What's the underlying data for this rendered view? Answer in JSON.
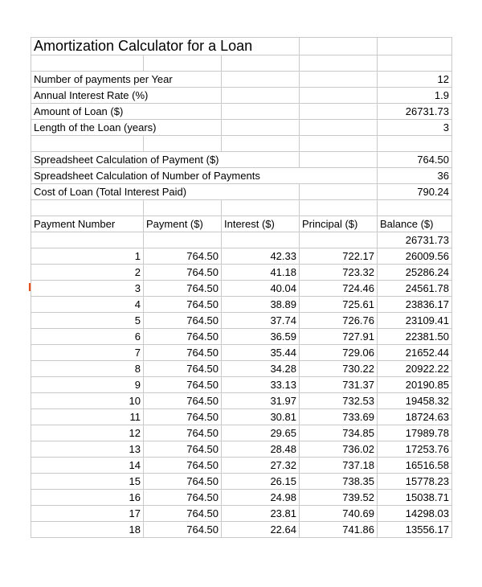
{
  "title": "Amortization Calculator for a Loan",
  "inputs": {
    "payments_per_year_label": "Number of payments per Year",
    "payments_per_year_value": "12",
    "annual_rate_label": "Annual Interest Rate (%)",
    "annual_rate_value": "1.9",
    "amount_label": "Amount of Loan ($)",
    "amount_value": "26731.73",
    "length_label": "Length of the Loan (years)",
    "length_value": "3"
  },
  "calc": {
    "payment_label": "Spreadsheet Calculation of Payment ($)",
    "payment_value": "764.50",
    "num_payments_label": "Spreadsheet Calculation of Number of Payments",
    "num_payments_value": "36",
    "cost_label": "Cost of Loan (Total Interest Paid)",
    "cost_value": "790.24"
  },
  "columns": {
    "c1": "Payment Number",
    "c2": "Payment ($)",
    "c3": "Interest ($)",
    "c4": "Principal ($)",
    "c5": "Balance ($)"
  },
  "start_balance": "26731.73",
  "rows": [
    {
      "n": "1",
      "pay": "764.50",
      "int": "42.33",
      "princ": "722.17",
      "bal": "26009.56"
    },
    {
      "n": "2",
      "pay": "764.50",
      "int": "41.18",
      "princ": "723.32",
      "bal": "25286.24"
    },
    {
      "n": "3",
      "pay": "764.50",
      "int": "40.04",
      "princ": "724.46",
      "bal": "24561.78"
    },
    {
      "n": "4",
      "pay": "764.50",
      "int": "38.89",
      "princ": "725.61",
      "bal": "23836.17"
    },
    {
      "n": "5",
      "pay": "764.50",
      "int": "37.74",
      "princ": "726.76",
      "bal": "23109.41"
    },
    {
      "n": "6",
      "pay": "764.50",
      "int": "36.59",
      "princ": "727.91",
      "bal": "22381.50"
    },
    {
      "n": "7",
      "pay": "764.50",
      "int": "35.44",
      "princ": "729.06",
      "bal": "21652.44"
    },
    {
      "n": "8",
      "pay": "764.50",
      "int": "34.28",
      "princ": "730.22",
      "bal": "20922.22"
    },
    {
      "n": "9",
      "pay": "764.50",
      "int": "33.13",
      "princ": "731.37",
      "bal": "20190.85"
    },
    {
      "n": "10",
      "pay": "764.50",
      "int": "31.97",
      "princ": "732.53",
      "bal": "19458.32"
    },
    {
      "n": "11",
      "pay": "764.50",
      "int": "30.81",
      "princ": "733.69",
      "bal": "18724.63"
    },
    {
      "n": "12",
      "pay": "764.50",
      "int": "29.65",
      "princ": "734.85",
      "bal": "17989.78"
    },
    {
      "n": "13",
      "pay": "764.50",
      "int": "28.48",
      "princ": "736.02",
      "bal": "17253.76"
    },
    {
      "n": "14",
      "pay": "764.50",
      "int": "27.32",
      "princ": "737.18",
      "bal": "16516.58"
    },
    {
      "n": "15",
      "pay": "764.50",
      "int": "26.15",
      "princ": "738.35",
      "bal": "15778.23"
    },
    {
      "n": "16",
      "pay": "764.50",
      "int": "24.98",
      "princ": "739.52",
      "bal": "15038.71"
    },
    {
      "n": "17",
      "pay": "764.50",
      "int": "23.81",
      "princ": "740.69",
      "bal": "14298.03"
    },
    {
      "n": "18",
      "pay": "764.50",
      "int": "22.64",
      "princ": "741.86",
      "bal": "13556.17"
    }
  ]
}
